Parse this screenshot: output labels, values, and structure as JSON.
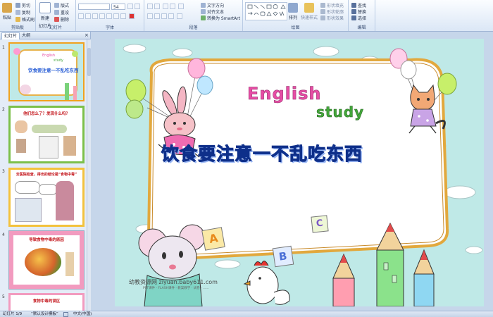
{
  "ribbon": {
    "clipboard": {
      "paste": "粘贴",
      "cut": "剪切",
      "copy": "复制",
      "format_painter": "格式刷",
      "group": "剪贴板"
    },
    "slides": {
      "new_slide": "新建",
      "new_slide2": "幻灯片",
      "layout": "版式",
      "reset": "重设",
      "delete": "删除",
      "group": "幻灯片"
    },
    "font": {
      "font_size": "54",
      "group": "字体"
    },
    "paragraph": {
      "text_direction": "文字方向",
      "align_text": "对齐文本",
      "smartart": "转换为 SmartArt",
      "group": "段落"
    },
    "drawing": {
      "arrange": "排列",
      "quick_styles": "快速样式",
      "shape_fill": "形状填充",
      "shape_outline": "形状轮廓",
      "shape_effects": "形状效果",
      "group": "绘图"
    },
    "editing": {
      "find": "查找",
      "replace": "替换",
      "select": "选择",
      "group": "编辑"
    }
  },
  "panel": {
    "tab_slides": "幻灯片",
    "tab_outline": "大纲",
    "thumbs": [
      {
        "num": "1",
        "en1": "English",
        "en2": "study",
        "title": "饮食要注意一不乱吃东西"
      },
      {
        "num": "2",
        "title": "他们怎么了？发现什么吗？"
      },
      {
        "num": "3",
        "title": "去医院检查，得出的结论是“食物中毒”"
      },
      {
        "num": "4",
        "title": "导致食物中毒的原因"
      },
      {
        "num": "5",
        "title": "食物中毒的误区"
      }
    ]
  },
  "slide": {
    "english": "English",
    "study": "study",
    "title": "饮食要注意一不乱吃东西",
    "letter_a": "A",
    "letter_b": "B",
    "letter_c": "C",
    "watermark": "幼教资源网 ziyuan.baby611.com",
    "watermark_sub": "PPT课件 · FLASH课件 · 教案教学 · 试卷 · ……"
  },
  "status": {
    "slide_count": "幻灯片 1/9",
    "theme": "“默认设计模板”",
    "language": "中文(中国)"
  },
  "colors": {
    "slide_bg": "#bfe9e7",
    "title_blue": "#2a5fd6",
    "english_pink": "#e64ea5",
    "study_green": "#43a63a",
    "thumb_sel": "#f0a21f"
  }
}
